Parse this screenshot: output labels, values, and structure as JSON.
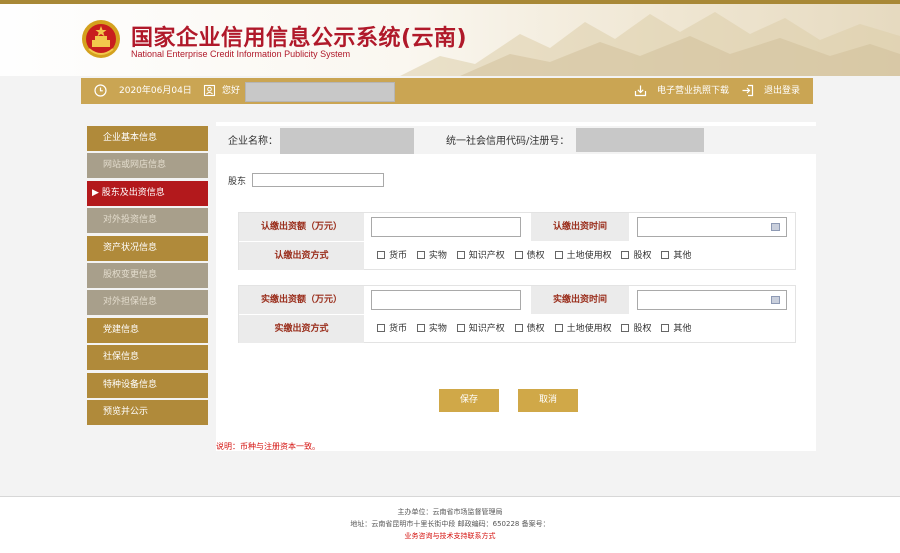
{
  "header": {
    "title_cn": "国家企业信用信息公示系统(云南)",
    "title_en": "National Enterprise Credit Information Publicity System"
  },
  "infobar": {
    "date": "2020年06月04日",
    "greeting": "您好",
    "download_label": "电子营业执照下载",
    "logout_label": "退出登录"
  },
  "sidebar": {
    "items": [
      {
        "label": "企业基本信息",
        "state": "normal"
      },
      {
        "label": "网站或网店信息",
        "state": "dim"
      },
      {
        "label": "▶ 股东及出资信息",
        "state": "active"
      },
      {
        "label": "对外投资信息",
        "state": "dim"
      },
      {
        "label": "资产状况信息",
        "state": "normal"
      },
      {
        "label": "股权变更信息",
        "state": "dim"
      },
      {
        "label": "对外担保信息",
        "state": "dim"
      },
      {
        "label": "党建信息",
        "state": "normal"
      },
      {
        "label": "社保信息",
        "state": "normal"
      },
      {
        "label": "特种设备信息",
        "state": "normal"
      },
      {
        "label": "预览并公示",
        "state": "normal"
      }
    ]
  },
  "company": {
    "name_label": "企业名称：",
    "code_label": "统一社会信用代码/注册号："
  },
  "form": {
    "shareholder_label": "股东",
    "shareholder_value": "",
    "subscribed_amount_label": "认缴出资额（万元）",
    "subscribed_date_label": "认缴出资时间",
    "subscribed_method_label": "认缴出资方式",
    "paid_amount_label": "实缴出资额（万元）",
    "paid_date_label": "实缴出资时间",
    "paid_method_label": "实缴出资方式",
    "methods": [
      "货币",
      "实物",
      "知识产权",
      "债权",
      "土地使用权",
      "股权",
      "其他"
    ]
  },
  "buttons": {
    "save": "保存",
    "cancel": "取消"
  },
  "note": "说明：币种与注册资本一致。",
  "footer": {
    "sponsor": "主办单位：云南省市场监督管理局",
    "address": "地址：云南省昆明市十里长街中段 邮政编码：650228 备案号：",
    "support": "业务咨询与技术支持联系方式"
  },
  "colors": {
    "brand_red": "#b0192a",
    "gold": "#caa553",
    "nav_gold": "#b08a3a",
    "nav_dim": "#a89f8b",
    "nav_active": "#b3191c",
    "button_gold": "#d0a848"
  }
}
